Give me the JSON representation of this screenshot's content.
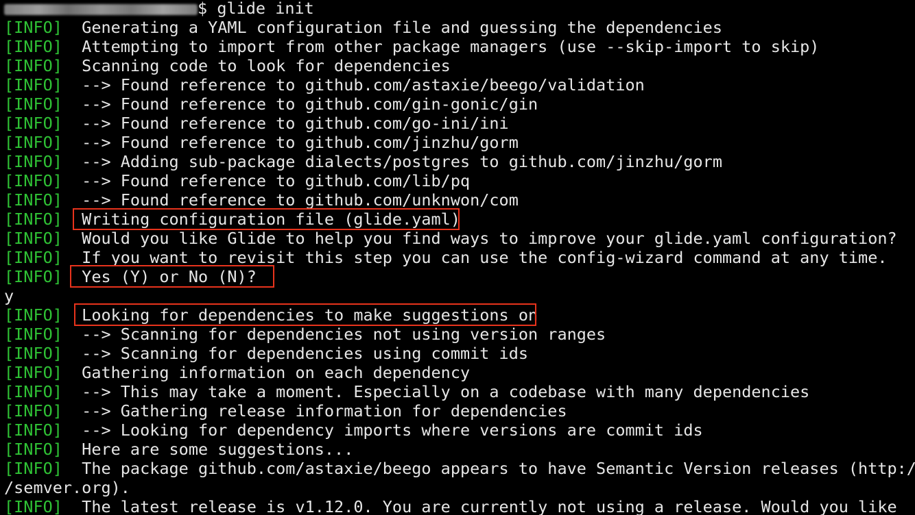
{
  "terminal": {
    "prompt_symbol": "$",
    "command": "glide init",
    "lines": [
      {
        "tag": "[INFO]",
        "text": "  Generating a YAML configuration file and guessing the dependencies"
      },
      {
        "tag": "[INFO]",
        "text": "  Attempting to import from other package managers (use --skip-import to skip)"
      },
      {
        "tag": "[INFO]",
        "text": "  Scanning code to look for dependencies"
      },
      {
        "tag": "[INFO]",
        "text": "  --> Found reference to github.com/astaxie/beego/validation"
      },
      {
        "tag": "[INFO]",
        "text": "  --> Found reference to github.com/gin-gonic/gin"
      },
      {
        "tag": "[INFO]",
        "text": "  --> Found reference to github.com/go-ini/ini"
      },
      {
        "tag": "[INFO]",
        "text": "  --> Found reference to github.com/jinzhu/gorm"
      },
      {
        "tag": "[INFO]",
        "text": "  --> Adding sub-package dialects/postgres to github.com/jinzhu/gorm"
      },
      {
        "tag": "[INFO]",
        "text": "  --> Found reference to github.com/lib/pq"
      },
      {
        "tag": "[INFO]",
        "text": "  --> Found reference to github.com/unknwon/com"
      },
      {
        "tag": "[INFO]",
        "text": "  Writing configuration file (glide.yaml)"
      },
      {
        "tag": "[INFO]",
        "text": "  Would you like Glide to help you find ways to improve your glide.yaml configuration?"
      },
      {
        "tag": "[INFO]",
        "text": "  If you want to revisit this step you can use the config-wizard command at any time."
      },
      {
        "tag": "[INFO]",
        "text": "  Yes (Y) or No (N)?"
      },
      {
        "tag": "",
        "text": "y"
      },
      {
        "tag": "[INFO]",
        "text": "  Looking for dependencies to make suggestions on"
      },
      {
        "tag": "[INFO]",
        "text": "  --> Scanning for dependencies not using version ranges"
      },
      {
        "tag": "[INFO]",
        "text": "  --> Scanning for dependencies using commit ids"
      },
      {
        "tag": "[INFO]",
        "text": "  Gathering information on each dependency"
      },
      {
        "tag": "[INFO]",
        "text": "  --> This may take a moment. Especially on a codebase with many dependencies"
      },
      {
        "tag": "[INFO]",
        "text": "  --> Gathering release information for dependencies"
      },
      {
        "tag": "[INFO]",
        "text": "  --> Looking for dependency imports where versions are commit ids"
      },
      {
        "tag": "[INFO]",
        "text": "  Here are some suggestions..."
      },
      {
        "tag": "[INFO]",
        "text": "  The package github.com/astaxie/beego appears to have Semantic Version releases (http:/"
      },
      {
        "tag": "",
        "text": "/semver.org)."
      },
      {
        "tag": "[INFO]",
        "text": "  The latest release is v1.12.0. You are currently not using a release. Would you like"
      }
    ]
  },
  "colors": {
    "background": "#000000",
    "text": "#e6e6e6",
    "info_tag": "#2fc235",
    "highlight_box": "#e8331c"
  }
}
